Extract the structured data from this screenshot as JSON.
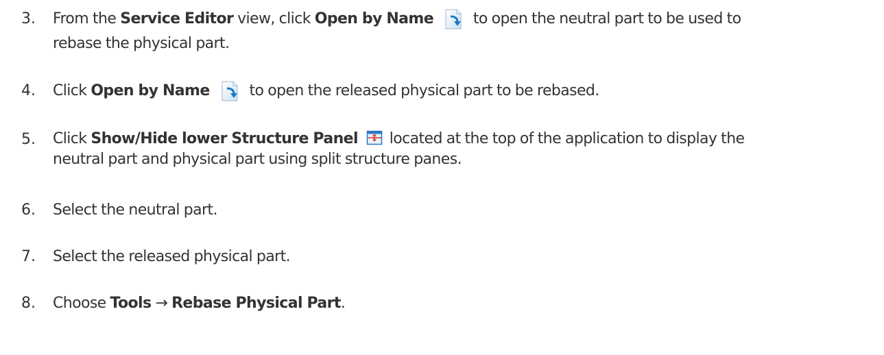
{
  "steps": [
    {
      "number": "3.",
      "pre": "From the ",
      "b1": "Service Editor",
      "mid": " view, click ",
      "b2": "Open by Name",
      "icon": "open-by-name-icon",
      "post1": " to open the neutral part to be used to",
      "post2": "rebase the physical part."
    },
    {
      "number": "4.",
      "pre": "Click ",
      "b1": "Open by Name",
      "icon": "open-by-name-icon",
      "post": " to open the released physical part to be rebased."
    },
    {
      "number": "5.",
      "pre": "Click ",
      "b1": "Show/Hide lower Structure Panel",
      "icon": "structure-panel-icon",
      "post1": " located at the top of the application to display the",
      "post2": "neutral part and physical part using split structure panes."
    },
    {
      "number": "6.",
      "text": "Select the neutral part."
    },
    {
      "number": "7.",
      "text": "Select the released physical part."
    },
    {
      "number": "8.",
      "pre": "Choose ",
      "b1": "Tools",
      "arrow": " → ",
      "b2": "Rebase Physical Part",
      "post": "."
    }
  ],
  "colors": {
    "text": "#333333",
    "icon_blue": "#1f77c8",
    "icon_doc": "#cfe0f2"
  }
}
